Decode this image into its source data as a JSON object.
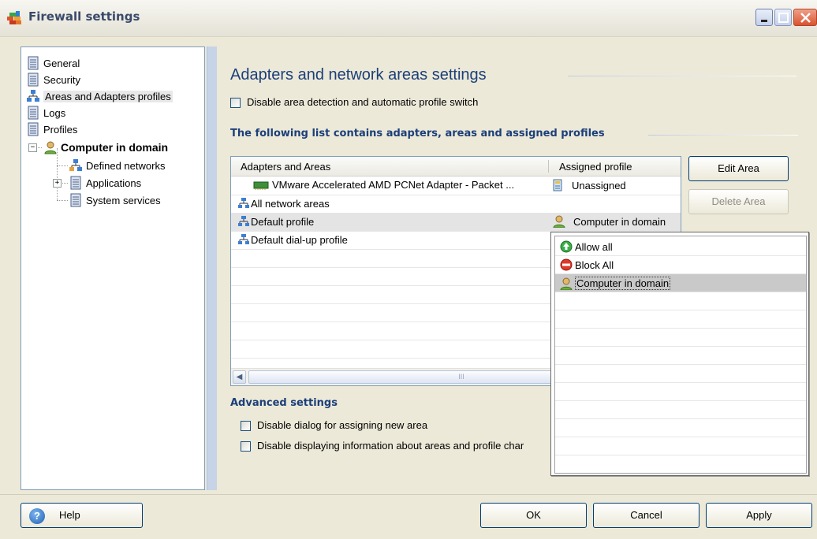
{
  "window": {
    "title": "Firewall settings"
  },
  "tree": {
    "items": [
      {
        "label": "General",
        "icon": "document-icon"
      },
      {
        "label": "Security",
        "icon": "document-icon"
      },
      {
        "label": "Areas and Adapters profiles",
        "icon": "network-icon",
        "selected": true
      },
      {
        "label": "Logs",
        "icon": "document-icon"
      },
      {
        "label": "Profiles",
        "icon": "document-icon"
      },
      {
        "label": "Computer in domain",
        "icon": "user-icon",
        "bold": true
      },
      {
        "label": "Defined networks",
        "icon": "network-icon"
      },
      {
        "label": "Applications",
        "icon": "document-icon"
      },
      {
        "label": "System services",
        "icon": "document-icon"
      }
    ]
  },
  "main": {
    "title": "Adapters and network areas settings",
    "disable_area_detection": {
      "label": "Disable area detection and automatic profile switch",
      "checked": false
    },
    "list_heading": "The following list contains adapters, areas and assigned profiles",
    "columns": [
      "Adapters and Areas",
      "Assigned profile"
    ],
    "rows": [
      {
        "area": "VMware Accelerated AMD PCNet Adapter - Packet ...",
        "profile": "Unassigned",
        "indent": true,
        "icon": "adapter-card-icon",
        "profile_icon": "unassigned-icon"
      },
      {
        "area": "All network areas",
        "profile": "",
        "icon": "network-icon"
      },
      {
        "area": "Default profile",
        "profile": "Computer in domain",
        "selected": true,
        "icon": "network-icon",
        "profile_icon": "user-icon"
      },
      {
        "area": "Default dial-up profile",
        "profile": "",
        "icon": "network-icon"
      }
    ],
    "scrollbar_grip": "III",
    "edit_area": "Edit Area",
    "delete_area": "Delete Area",
    "advanced_heading": "Advanced settings",
    "adv_disable_dialog": {
      "label": "Disable dialog for assigning new area",
      "checked": false
    },
    "adv_disable_info": {
      "label": "Disable displaying information about areas and profile char",
      "checked": false
    }
  },
  "profile_dropdown": {
    "options": [
      {
        "label": "Allow all",
        "icon": "allow-icon"
      },
      {
        "label": "Block All",
        "icon": "block-icon"
      },
      {
        "label": "Computer in domain",
        "icon": "user-icon",
        "selected": true
      }
    ]
  },
  "footer": {
    "help": "Help",
    "ok": "OK",
    "cancel": "Cancel",
    "apply": "Apply"
  },
  "colors": {
    "heading": "#1c3f7a",
    "window_bg": "#ece9d8",
    "selection": "#e4e4e4"
  }
}
